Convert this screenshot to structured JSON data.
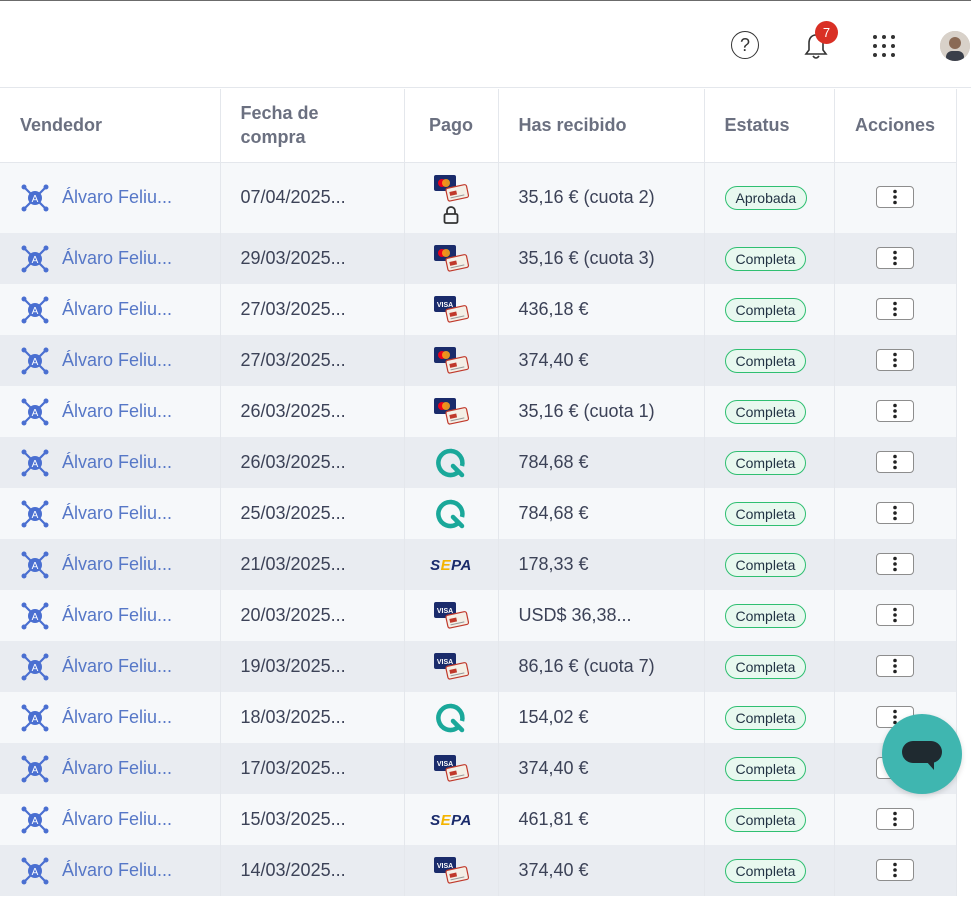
{
  "topbar": {
    "notifications_count": "7",
    "help_glyph": "?"
  },
  "table": {
    "headers": [
      "Vendedor",
      "Fecha de compra",
      "Pago",
      "Has recibido",
      "Estatus",
      "Acciones"
    ],
    "rows": [
      {
        "seller": "Álvaro Feliu...",
        "date": "07/04/2025...",
        "payment": "mastercard-card-icon",
        "locked": true,
        "received": "35,16 € (cuota 2)",
        "status": "Aprobada"
      },
      {
        "seller": "Álvaro Feliu...",
        "date": "29/03/2025...",
        "payment": "mastercard-card-icon",
        "received": "35,16 € (cuota 3)",
        "status": "Completa"
      },
      {
        "seller": "Álvaro Feliu...",
        "date": "27/03/2025...",
        "payment": "visa-card-icon",
        "received": "436,18 €",
        "status": "Completa"
      },
      {
        "seller": "Álvaro Feliu...",
        "date": "27/03/2025...",
        "payment": "mastercard-card-icon",
        "received": "374,40 €",
        "status": "Completa"
      },
      {
        "seller": "Álvaro Feliu...",
        "date": "26/03/2025...",
        "payment": "mastercard-card-icon",
        "received": "35,16 € (cuota 1)",
        "status": "Completa"
      },
      {
        "seller": "Álvaro Feliu...",
        "date": "26/03/2025...",
        "payment": "quaderno-q-icon",
        "received": "784,68 €",
        "status": "Completa"
      },
      {
        "seller": "Álvaro Feliu...",
        "date": "25/03/2025...",
        "payment": "quaderno-q-icon",
        "received": "784,68 €",
        "status": "Completa"
      },
      {
        "seller": "Álvaro Feliu...",
        "date": "21/03/2025...",
        "payment": "sepa-icon",
        "received": "178,33 €",
        "status": "Completa"
      },
      {
        "seller": "Álvaro Feliu...",
        "date": "20/03/2025...",
        "payment": "visa-card-icon",
        "received": "USD$ 36,38...",
        "status": "Completa"
      },
      {
        "seller": "Álvaro Feliu...",
        "date": "19/03/2025...",
        "payment": "visa-card-icon",
        "received": "86,16 € (cuota 7)",
        "status": "Completa"
      },
      {
        "seller": "Álvaro Feliu...",
        "date": "18/03/2025...",
        "payment": "quaderno-q-icon",
        "received": "154,02 €",
        "status": "Completa"
      },
      {
        "seller": "Álvaro Feliu...",
        "date": "17/03/2025...",
        "payment": "visa-card-icon",
        "received": "374,40 €",
        "status": "Completa"
      },
      {
        "seller": "Álvaro Feliu...",
        "date": "15/03/2025...",
        "payment": "sepa-icon",
        "received": "461,81 €",
        "status": "Completa"
      },
      {
        "seller": "Álvaro Feliu...",
        "date": "14/03/2025...",
        "payment": "visa-card-icon",
        "received": "374,40 €",
        "status": "Completa"
      }
    ]
  },
  "sepa_text": "SEPA",
  "visa_text": "VISA",
  "colors": {
    "link": "#5677c7",
    "status_border": "#2fbf71",
    "chat": "#3fb6b0",
    "badge": "#d93025"
  }
}
